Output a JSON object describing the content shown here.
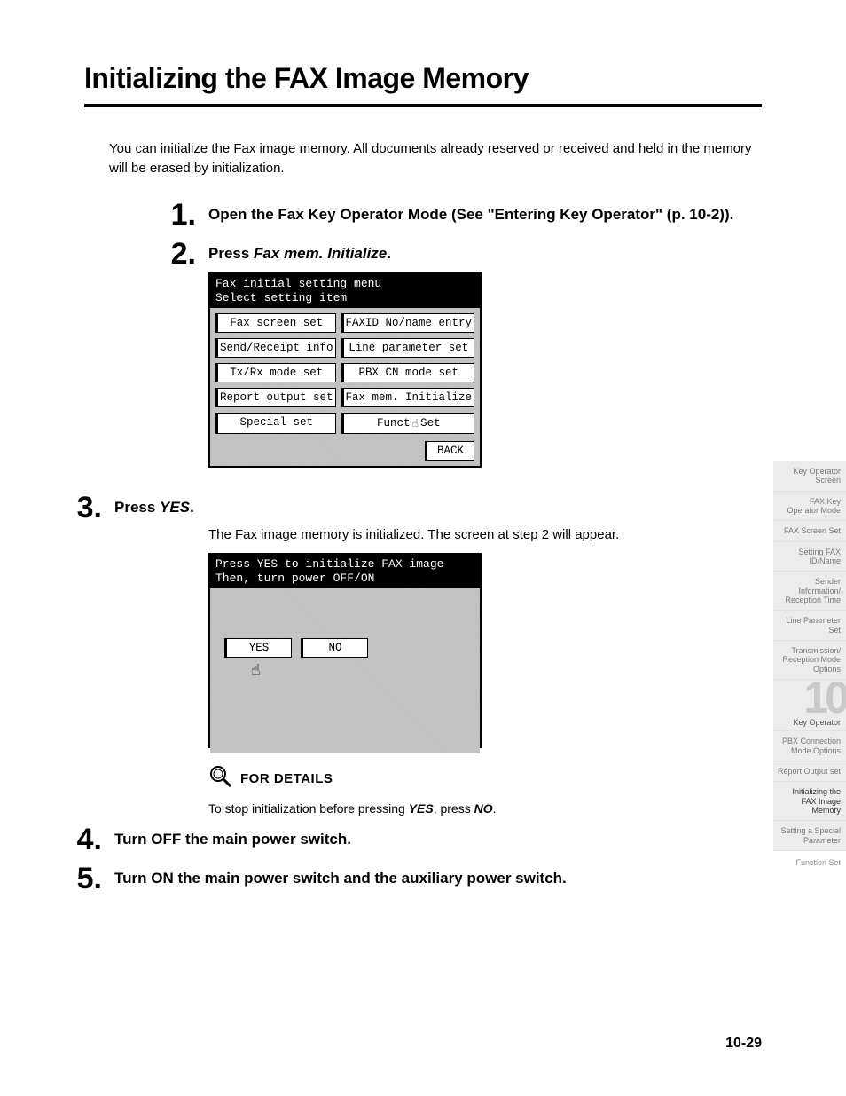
{
  "title": "Initializing the FAX Image Memory",
  "intro": "You can initialize the Fax image memory. All documents already reserved or received and held in the memory will be erased by initialization.",
  "steps": {
    "s1": {
      "num": "1.",
      "head_a": "Open the Fax Key Operator Mode (See \"Entering Key Operator\" (p. 10-2))."
    },
    "s2": {
      "num": "2.",
      "head_a": "Press ",
      "head_em": "Fax mem. Initialize",
      "head_b": "."
    },
    "s3": {
      "num": "3.",
      "head_a": "Press ",
      "head_em": "YES",
      "head_b": ".",
      "text": "The Fax image memory is initialized. The screen at step 2 will appear."
    },
    "s4": {
      "num": "4.",
      "head_a": "Turn OFF the main power switch."
    },
    "s5": {
      "num": "5.",
      "head_a": "Turn ON the main power switch and the auxiliary power switch."
    }
  },
  "lcd1": {
    "header": "Fax initial setting menu\nSelect setting item",
    "buttons": [
      "Fax screen set",
      "FAXID No/name entry",
      "Send/Receipt info",
      "Line parameter set",
      "Tx/Rx mode set",
      "PBX CN mode set",
      "Report output set",
      "Fax mem. Initialize",
      "Special set"
    ],
    "func": "Funct",
    "func2": "Set",
    "back": "BACK"
  },
  "lcd2": {
    "header": "Press YES to initialize FAX image\nThen, turn power OFF/ON",
    "yes": "YES",
    "no": "NO"
  },
  "details": {
    "label": "FOR DETAILS",
    "text_a": "To stop initialization before pressing ",
    "text_em1": "YES",
    "text_b": ", press ",
    "text_em2": "NO",
    "text_c": "."
  },
  "sidebar": {
    "tabs": [
      "Key Operator Screen",
      "FAX Key Operator Mode",
      "FAX Screen Set",
      "Setting FAX ID/Name",
      "Sender Information/ Reception Time",
      "Line Parameter Set",
      "Transmission/ Reception Mode Options"
    ],
    "chapter_num": "10",
    "chapter_label": "Key Operator",
    "tabs2": [
      "PBX Connection Mode Options",
      "Report Output set"
    ],
    "current": "Initializing the FAX Image Memory",
    "tabs3": [
      "Setting a Special Parameter",
      "Function Set"
    ]
  },
  "pagenum": "10-29"
}
